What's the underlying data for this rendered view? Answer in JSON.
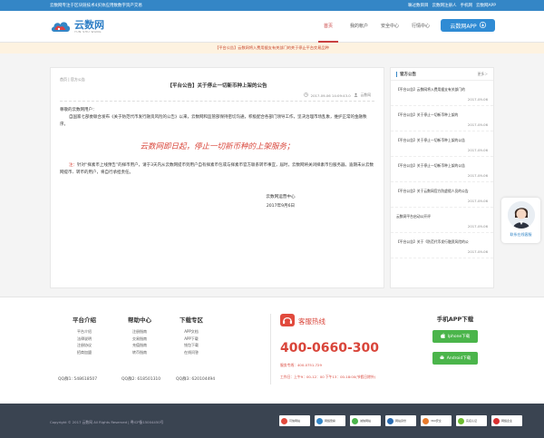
{
  "topbar": {
    "slogan": "云数网专注于区块链技术4买体应用数数字资产交易",
    "welcome": "嘛过数目目",
    "user": "云数网注册人",
    "phone_link": "手机网",
    "app_link": "云数网APP"
  },
  "header": {
    "logo_cn": "云数网",
    "logo_en": "YUN SHU WANG",
    "nav": [
      "首页",
      "我的帐户",
      "安全中心",
      "行情中心",
      "钱包下载"
    ],
    "app_button": "云数网APP"
  },
  "notice": "【平台公告】云数网将入费用据支有关部门的关于停止平台交易品种",
  "article": {
    "breadcrumb": "首页 | 官方公告",
    "title": "【平台公告】关于停止一切新币种上架的公告",
    "date": "2017-09-06 14:09:43.0",
    "author": "云数网",
    "greeting": "尊敬的云数网用户：",
    "para1": "自国家七部委联合发布《关于防范代币发行融资风险的公告》以来，云数网和监管部保持密切沟通，积极配合各部门领导工作，坚决治理市场乱象，维护正常的金融秩序。",
    "slogan": "云数网即日起，停止一切新币种的上架服务；",
    "para2_red": "注：",
    "para2": "针对“择素币上线预告”的择币用户，请于3天内从云数网提币到用户自有择素币包或与择素币官方联系转币事宜，届时，云数网将关闭择素币包服务器。逾期未从云数网提币、转币的用户，将自行承担责任。",
    "sign_org": "云数网运营中心",
    "sign_date": "2017年9月6日"
  },
  "sidebar": {
    "title": "官方公告",
    "more": "更多＞",
    "items": [
      {
        "title": "【平台公告】云数网将入费用据支有关部门的",
        "date": "2017-09-06"
      },
      {
        "title": "【平台公告】关于停止一切新币种上架的",
        "date": "2017-09-06"
      },
      {
        "title": "【平台公告】关于停止一切新币种上架的公告",
        "date": "2017-09-06"
      },
      {
        "title": "【平台公告】关于停止一切新币种上架的公告",
        "date": "2017-09-06"
      },
      {
        "title": "【平台公告】关于云数网官方防虚假人员的公告",
        "date": "2017-09-06"
      },
      {
        "title": "云数网平台启动公开评",
        "date": "2017-09-06"
      },
      {
        "title": "【平台公告】关于《防范代币发行融资风险的公",
        "date": "2017-09-06"
      }
    ]
  },
  "service": {
    "label": "联系在线客服"
  },
  "footer": {
    "cols": [
      {
        "heading": "平台介绍",
        "links": [
          "平台介绍",
          "法律说明",
          "注册协议",
          "招商加盟"
        ]
      },
      {
        "heading": "帮助中心",
        "links": [
          "注册指南",
          "交易指南",
          "充值指南",
          "转币指南"
        ]
      },
      {
        "heading": "下载专区",
        "links": [
          "APP文档",
          "APP下载",
          "钱包下载",
          "在线问答"
        ]
      }
    ],
    "qq": [
      "QQ群1: 548618507",
      "QQ群2: 618501310",
      "QQ群3: 620104494"
    ],
    "hotline_title": "客服热线",
    "hotline_number": "400-0660-300",
    "hotline_mobile": "服务专线：400-0751-729",
    "hotline_hours": "工作日：上午9：00-12：00 下午13：00-18:00(节假日除外)",
    "app_heading": "手机APP下载",
    "iphone_label": "Iphone下载",
    "android_label": "Android下载"
  },
  "bottom": {
    "copyright": "Copyright © 2017 云数网 All Rights Reserved | 粤ICP备15004450号",
    "badges": [
      "可信网站",
      "网络警察",
      "诚信网站",
      "网站身份",
      "360安全",
      "实名认证",
      "网络企业"
    ]
  },
  "colors": {
    "brand_blue": "#3486c6",
    "accent_red": "#d9453a",
    "android_green": "#4bb54b",
    "footer_dark": "#3a4451"
  }
}
